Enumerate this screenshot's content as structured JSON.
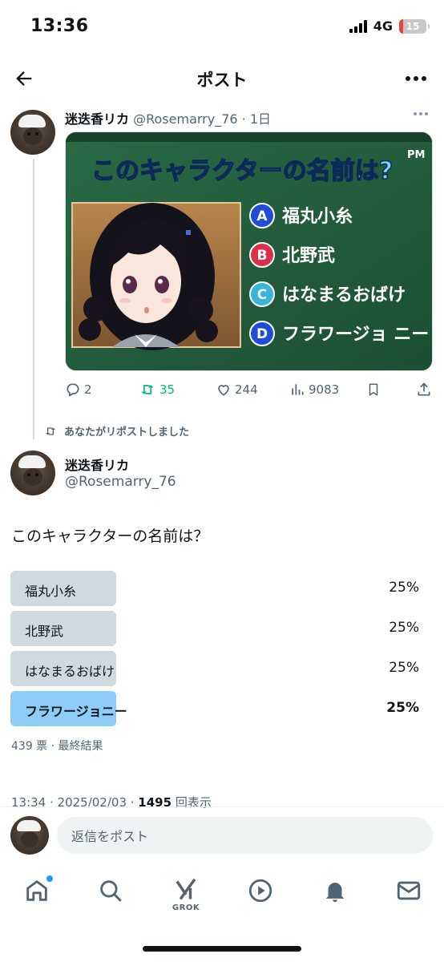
{
  "status_bar": {
    "time": "13:36",
    "network": "4G",
    "battery": "15"
  },
  "header": {
    "title": "ポスト",
    "back_icon": "arrow-left-icon",
    "more_icon": "more-horizontal-icon"
  },
  "quoted_post": {
    "display_name": "迷迭香リカ",
    "handle": "@Rosemarry_76",
    "separator": "·",
    "time": "1日",
    "image": {
      "title": "このキャラクターの名前は?",
      "corner_mark": "PM",
      "options": [
        {
          "letter": "A",
          "text": "福丸小糸",
          "color": "#1e4bd8"
        },
        {
          "letter": "B",
          "text": "北野武",
          "color": "#d8324b"
        },
        {
          "letter": "C",
          "text": "はなまるおばけ",
          "color": "#3bb3d6"
        },
        {
          "letter": "D",
          "text": "フラワージョ ニー",
          "color": "#1e4bd8"
        }
      ]
    },
    "actions": {
      "replies": "2",
      "reposts": "35",
      "likes": "244",
      "views": "9083"
    }
  },
  "repost_notice": "あなたがリポストしました",
  "post": {
    "display_name": "迷迭香リカ",
    "handle": "@Rosemarry_76",
    "text": "このキャラクターの名前は？",
    "poll": {
      "options": [
        {
          "label": "福丸小糸",
          "percent": "25%",
          "winner": false
        },
        {
          "label": "北野武",
          "percent": "25%",
          "winner": false
        },
        {
          "label": "はなまるおばけ",
          "percent": "25%",
          "winner": false
        },
        {
          "label": "フラワージョニー",
          "percent": "25%",
          "winner": true
        }
      ],
      "footer": "439 票 · 最終結果"
    },
    "timestamp": "13:34 · 2025/02/03 · ",
    "views_count": "1495",
    "views_label": " 回表示"
  },
  "reply_bar": {
    "placeholder": "返信をポスト"
  },
  "tabbar": {
    "grok_label": "GROK"
  },
  "colors": {
    "accent": "#1d9bf0",
    "retweet": "#00ba7c",
    "poll_winner": "#8ecdf8",
    "poll_other": "#cfd9de",
    "board_green": "#1f5a3b"
  }
}
